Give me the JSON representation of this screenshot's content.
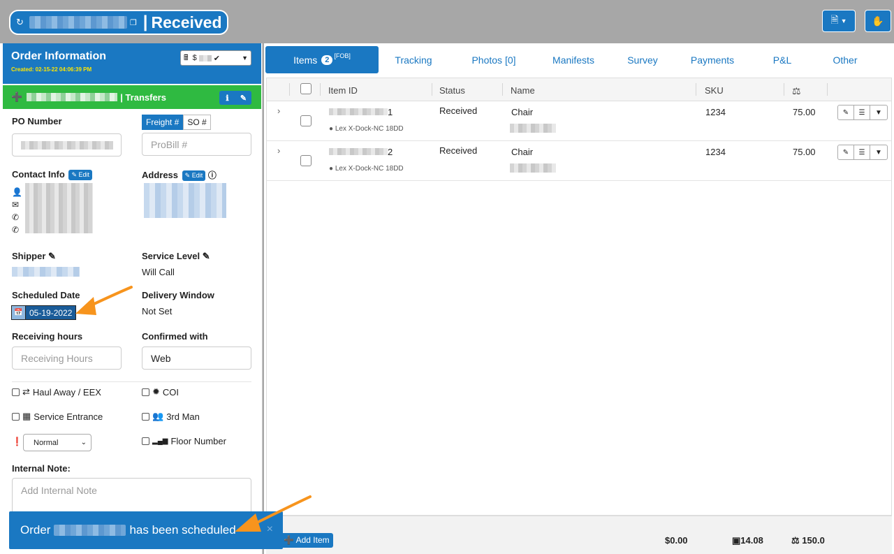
{
  "header": {
    "status": "Received",
    "separator": "|",
    "refresh_icon": "refresh-icon",
    "copy_icon": "copy-icon",
    "doc_icon": "document-icon",
    "hand_icon": "hand-icon"
  },
  "order_info": {
    "title": "Order Information",
    "created": "Created: 02-15-22 04:06:39 PM",
    "select_prefix": "$"
  },
  "transfers": {
    "label": "| Transfers"
  },
  "form": {
    "po_number_label": "PO Number",
    "freight_toggle": "Freight #",
    "so_toggle": "SO #",
    "probill_placeholder": "ProBill #",
    "contact_info_label": "Contact Info",
    "edit_label": "Edit",
    "address_label": "Address",
    "shipper_label": "Shipper",
    "service_level_label": "Service Level",
    "service_level_value": "Will Call",
    "scheduled_date_label": "Scheduled Date",
    "scheduled_date_value": "05-19-2022",
    "delivery_window_label": "Delivery Window",
    "delivery_window_value": "Not Set",
    "receiving_hours_label": "Receiving hours",
    "receiving_hours_placeholder": "Receiving Hours",
    "confirmed_with_label": "Confirmed with",
    "confirmed_with_value": "Web",
    "haul_away": "Haul Away / EEX",
    "coi": "COI",
    "service_entrance": "Service Entrance",
    "third_man": "3rd Man",
    "priority_value": "Normal",
    "floor_number": "Floor Number",
    "internal_note_label": "Internal Note:",
    "internal_note_placeholder": "Add Internal Note"
  },
  "tabs": [
    {
      "label": "Items",
      "badge": "2",
      "tag": "[FOB]"
    },
    {
      "label": "Tracking"
    },
    {
      "label": "Photos [0]"
    },
    {
      "label": "Manifests"
    },
    {
      "label": "Survey"
    },
    {
      "label": "Payments"
    },
    {
      "label": "P&L"
    },
    {
      "label": "Other"
    }
  ],
  "table": {
    "columns": [
      "Item ID",
      "Status",
      "Name",
      "SKU"
    ],
    "rows": [
      {
        "id_suffix": "1",
        "status": "Received",
        "name": "Chair",
        "sku": "1234",
        "weight": "75.00",
        "location": "Lex X-Dock-NC 18DD"
      },
      {
        "id_suffix": "2",
        "status": "Received",
        "name": "Chair",
        "sku": "1234",
        "weight": "75.00",
        "location": "Lex X-Dock-NC 18DD"
      }
    ]
  },
  "footer": {
    "add_item": "Add Item",
    "total_cost": "$0.00",
    "total_volume": "14.08",
    "total_weight": "150.0"
  },
  "toast": {
    "prefix": "Order",
    "suffix": "has been scheduled",
    "close": "×"
  },
  "colors": {
    "primary": "#1a78c2",
    "success": "#2fba41",
    "highlight": "#ffe600",
    "arrow": "#f7941d"
  }
}
